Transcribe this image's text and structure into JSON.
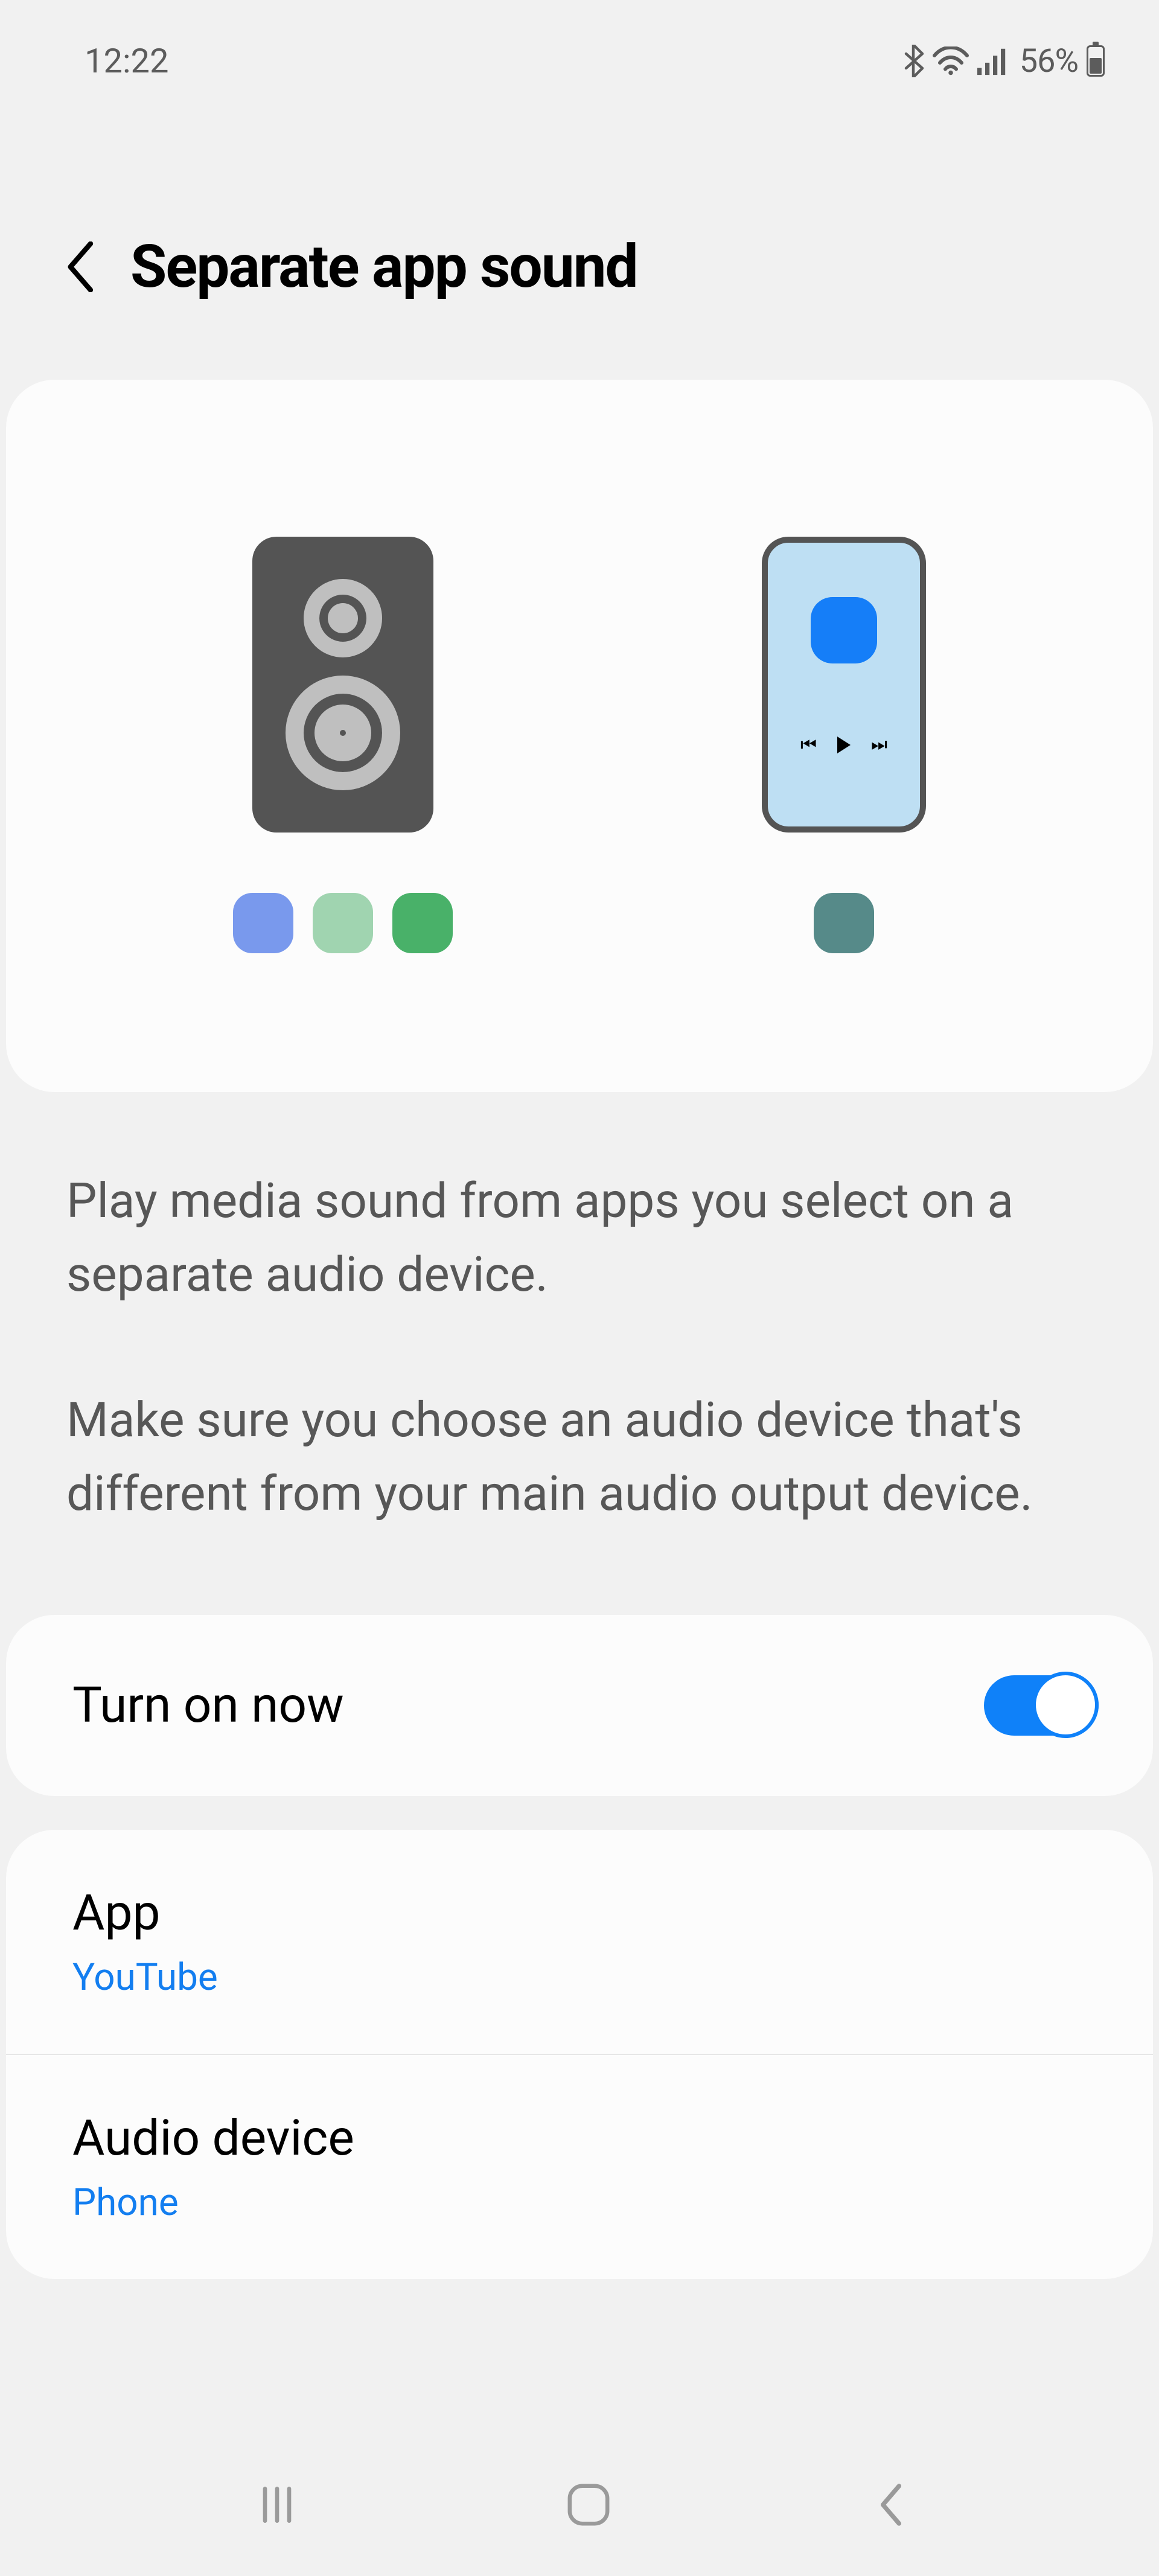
{
  "status": {
    "time": "12:22",
    "battery_text": "56%"
  },
  "header": {
    "title": "Separate app sound"
  },
  "description": {
    "p1": "Play media sound from apps you select on a separate audio device.",
    "p2": "Make sure you choose an audio device that's different from your main audio output device."
  },
  "toggle": {
    "label": "Turn on now",
    "on": true
  },
  "rows": {
    "app": {
      "title": "App",
      "value": "YouTube"
    },
    "device": {
      "title": "Audio device",
      "value": "Phone"
    }
  }
}
